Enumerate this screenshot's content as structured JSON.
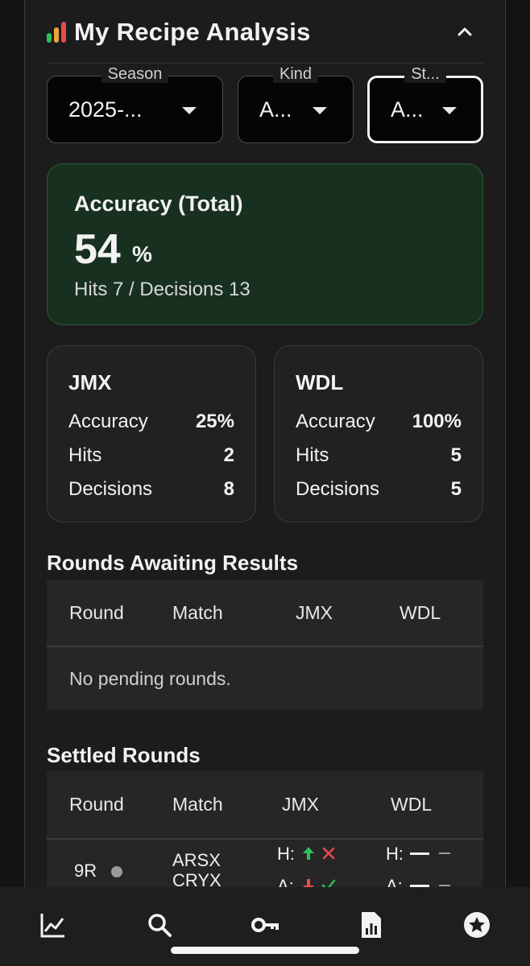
{
  "header": {
    "title": "My Recipe Analysis",
    "colors": {
      "bar1": "#2fbf5b",
      "bar2": "#f0a23a",
      "bar3": "#e84b4b"
    }
  },
  "filters": [
    {
      "legend": "Season",
      "value": "2025-..."
    },
    {
      "legend": "Kind",
      "value": "A..."
    },
    {
      "legend": "St...",
      "value": "A..."
    }
  ],
  "accuracy": {
    "label": "Accuracy (Total)",
    "value": "54",
    "unit": "%",
    "sub": "Hits 7 / Decisions 13"
  },
  "cards": [
    {
      "name": "JMX",
      "rows": [
        {
          "label": "Accuracy",
          "value": "25%"
        },
        {
          "label": "Hits",
          "value": "2"
        },
        {
          "label": "Decisions",
          "value": "8"
        }
      ]
    },
    {
      "name": "WDL",
      "rows": [
        {
          "label": "Accuracy",
          "value": "100%"
        },
        {
          "label": "Hits",
          "value": "5"
        },
        {
          "label": "Decisions",
          "value": "5"
        }
      ]
    }
  ],
  "pending": {
    "title": "Rounds Awaiting Results",
    "columns": [
      "Round",
      "Match",
      "JMX",
      "WDL"
    ],
    "empty": "No pending rounds."
  },
  "settled": {
    "title": "Settled Rounds",
    "columns": [
      "Round",
      "Match",
      "JMX",
      "WDL"
    ],
    "rows": [
      {
        "round": "9R",
        "match_home": "ARSX",
        "match_away": "CRYX",
        "jmx_h": "H:",
        "jmx_a": "A:",
        "wdl_h": "H:",
        "wdl_a": "A:"
      }
    ]
  },
  "nav": [
    "chart-icon",
    "search-icon",
    "key-icon",
    "report-icon",
    "star-icon"
  ]
}
